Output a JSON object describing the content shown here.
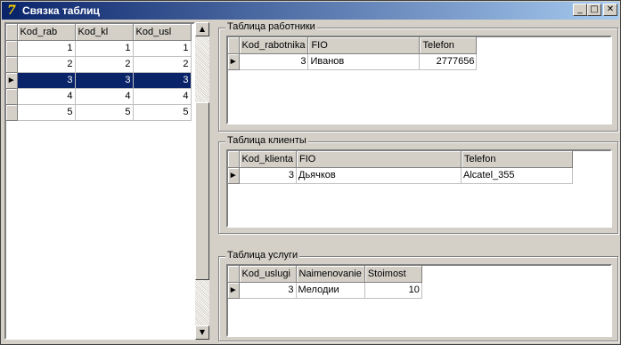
{
  "window": {
    "title": "Связка таблиц",
    "icon": "delphi-icon",
    "buttons": [
      "minimize",
      "maximize",
      "close"
    ]
  },
  "left_grid": {
    "columns": [
      "Kod_rab",
      "Kod_kl",
      "Kod_usl"
    ],
    "rows": [
      [
        "1",
        "1",
        "1"
      ],
      [
        "2",
        "2",
        "2"
      ],
      [
        "3",
        "3",
        "3"
      ],
      [
        "4",
        "4",
        "4"
      ],
      [
        "5",
        "5",
        "5"
      ]
    ],
    "selected_row": 2,
    "indicator": "►"
  },
  "workers": {
    "caption": "Таблица работники",
    "columns": [
      "Kod_rabotnika",
      "FIO",
      "Telefon"
    ],
    "rows": [
      [
        "3",
        "Иванов",
        "2777656"
      ]
    ]
  },
  "clients": {
    "caption": "Таблица клиенты",
    "columns": [
      "Kod_klienta",
      "FIO",
      "Telefon"
    ],
    "rows": [
      [
        "3",
        "Дьячков",
        "Alcatel_355"
      ]
    ]
  },
  "services": {
    "caption": "Таблица услуги",
    "columns": [
      "Kod_uslugi",
      "Naimenovanie",
      "Stoimost"
    ],
    "rows": [
      [
        "3",
        "Мелодии",
        "10"
      ]
    ]
  },
  "colors": {
    "selection": "#0a246a",
    "face": "#d4d0c8"
  }
}
